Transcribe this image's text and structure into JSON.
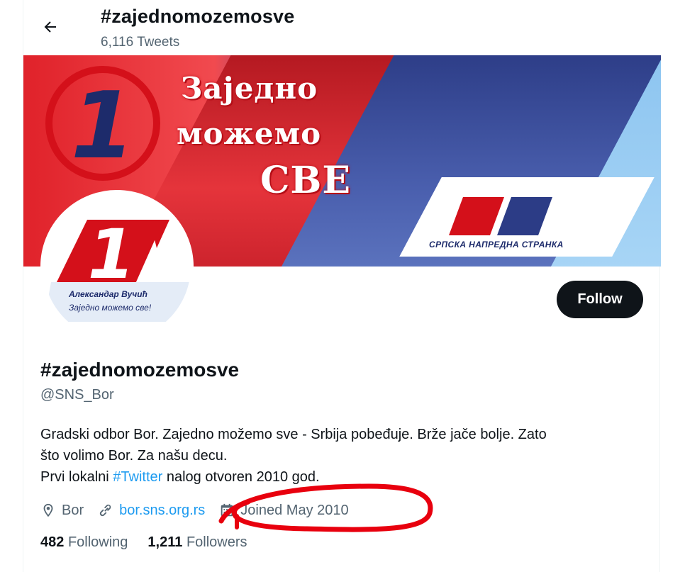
{
  "header": {
    "title": "#zajednomozemosve",
    "tweet_count": "6,116 Tweets"
  },
  "banner": {
    "line1": "Заједно",
    "line2": "можемо",
    "line3": "СВЕ",
    "number": "1",
    "party": "СРПСКА НАПРЕДНА СТРАНКА"
  },
  "avatar": {
    "number": "1",
    "name": "Александар Вучић",
    "slogan": "Заједно можемо све!"
  },
  "actions": {
    "follow_label": "Follow"
  },
  "profile": {
    "name": "#zajednomozemosve",
    "handle": "@SNS_Bor",
    "bio_line1": "Gradski odbor Bor.  Zajedno možemo sve - Srbija pobeđuje. Brže jače bolje. Zato",
    "bio_line2": "što volimo Bor. Za našu decu.",
    "bio_line3_pre": "Prvi lokalni ",
    "bio_line3_tag": "#Twitter",
    "bio_line3_post": " nalog otvoren 2010 god.",
    "location": "Bor",
    "website": "bor.sns.org.rs",
    "joined": "Joined May 2010"
  },
  "stats": {
    "following_count": "482",
    "following_label": "Following",
    "followers_count": "1,211",
    "followers_label": "Followers"
  },
  "colors": {
    "accent": "#1d9bf0",
    "text": "#0f1419",
    "muted": "#536471",
    "annotation": "#e8000e"
  },
  "icons": [
    "back-arrow-icon",
    "location-pin-icon",
    "link-icon",
    "calendar-icon"
  ]
}
